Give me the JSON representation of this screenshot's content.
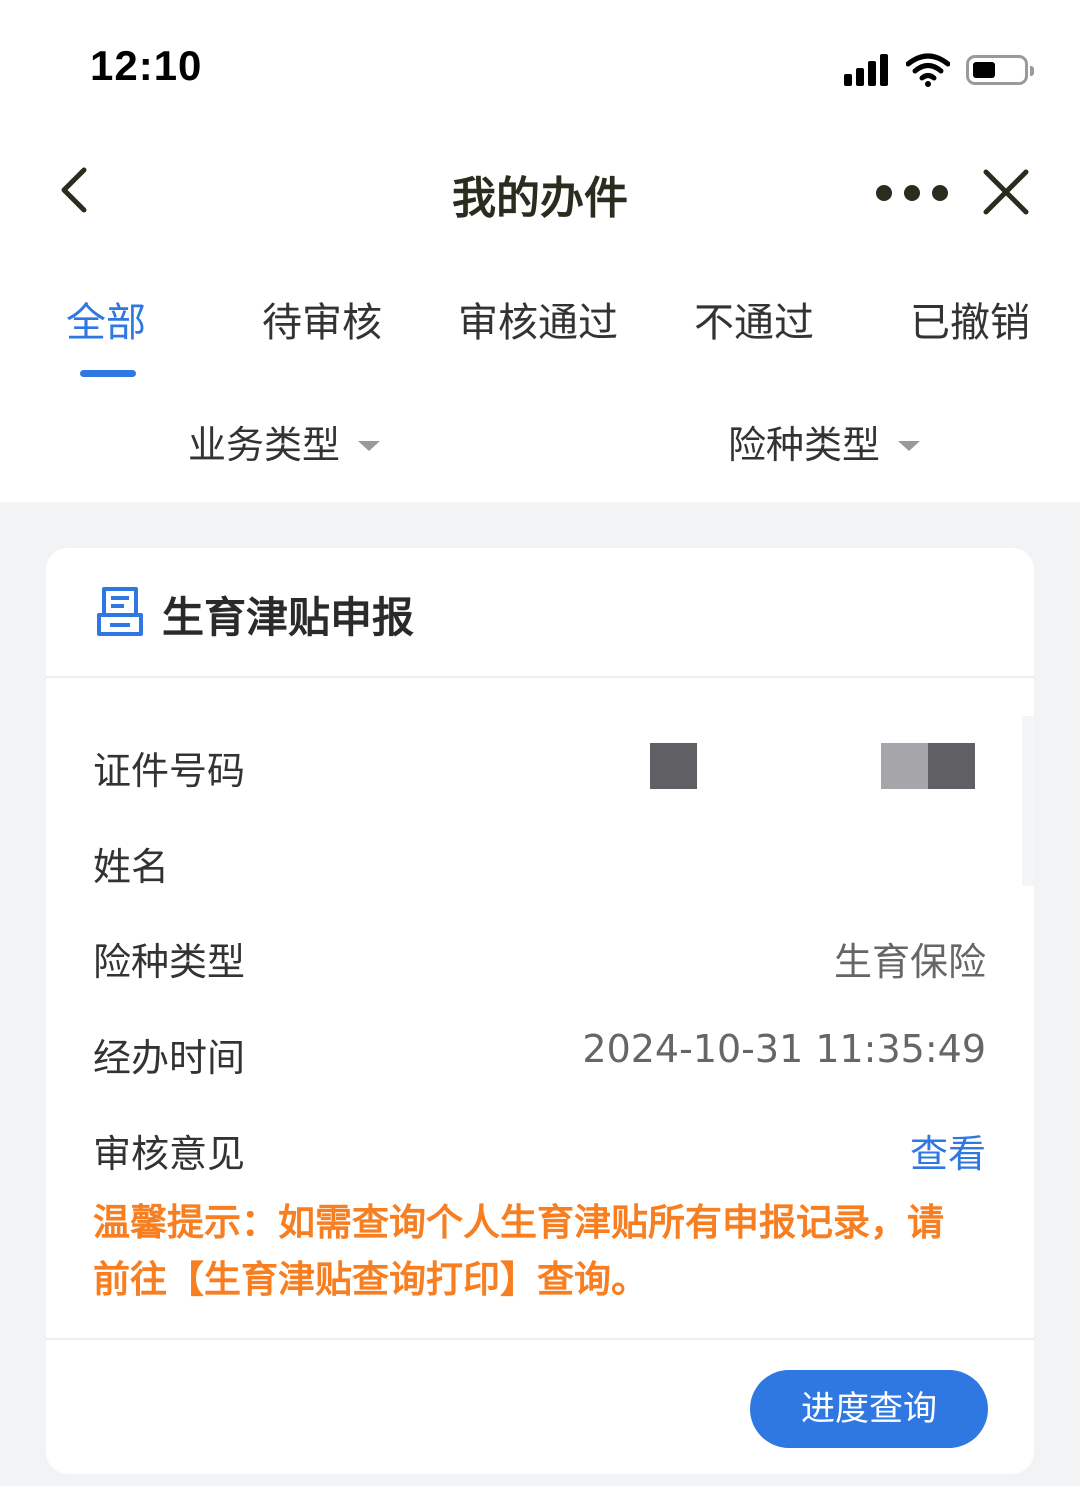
{
  "status_bar": {
    "time": "12:10"
  },
  "nav": {
    "title": "我的办件",
    "back_icon": "chevron-left-icon",
    "more_icon": "more-dots-icon",
    "close_icon": "close-icon"
  },
  "tabs": [
    {
      "label": "全部",
      "active": true
    },
    {
      "label": "待审核",
      "active": false
    },
    {
      "label": "审核通过",
      "active": false
    },
    {
      "label": "不通过",
      "active": false
    },
    {
      "label": "已撤销",
      "active": false
    }
  ],
  "filters": [
    {
      "label": "业务类型"
    },
    {
      "label": "险种类型"
    }
  ],
  "card": {
    "icon": "document-icon",
    "title": "生育津贴申报",
    "rows": [
      {
        "label": "证件号码",
        "value": ""
      },
      {
        "label": "姓名",
        "value": ""
      },
      {
        "label": "险种类型",
        "value": "生育保险"
      },
      {
        "label": "经办时间",
        "value": "2024-10-31 11:35:49"
      },
      {
        "label": "审核意见",
        "link": "查看"
      }
    ],
    "tip": "温馨提示：如需查询个人生育津贴所有申报记录，请前往【生育津贴查询打印】查询。",
    "progress_button": "进度查询"
  },
  "colors": {
    "accent": "#2f78e2",
    "tip": "#f77f22",
    "background": "#f2f3f5"
  }
}
